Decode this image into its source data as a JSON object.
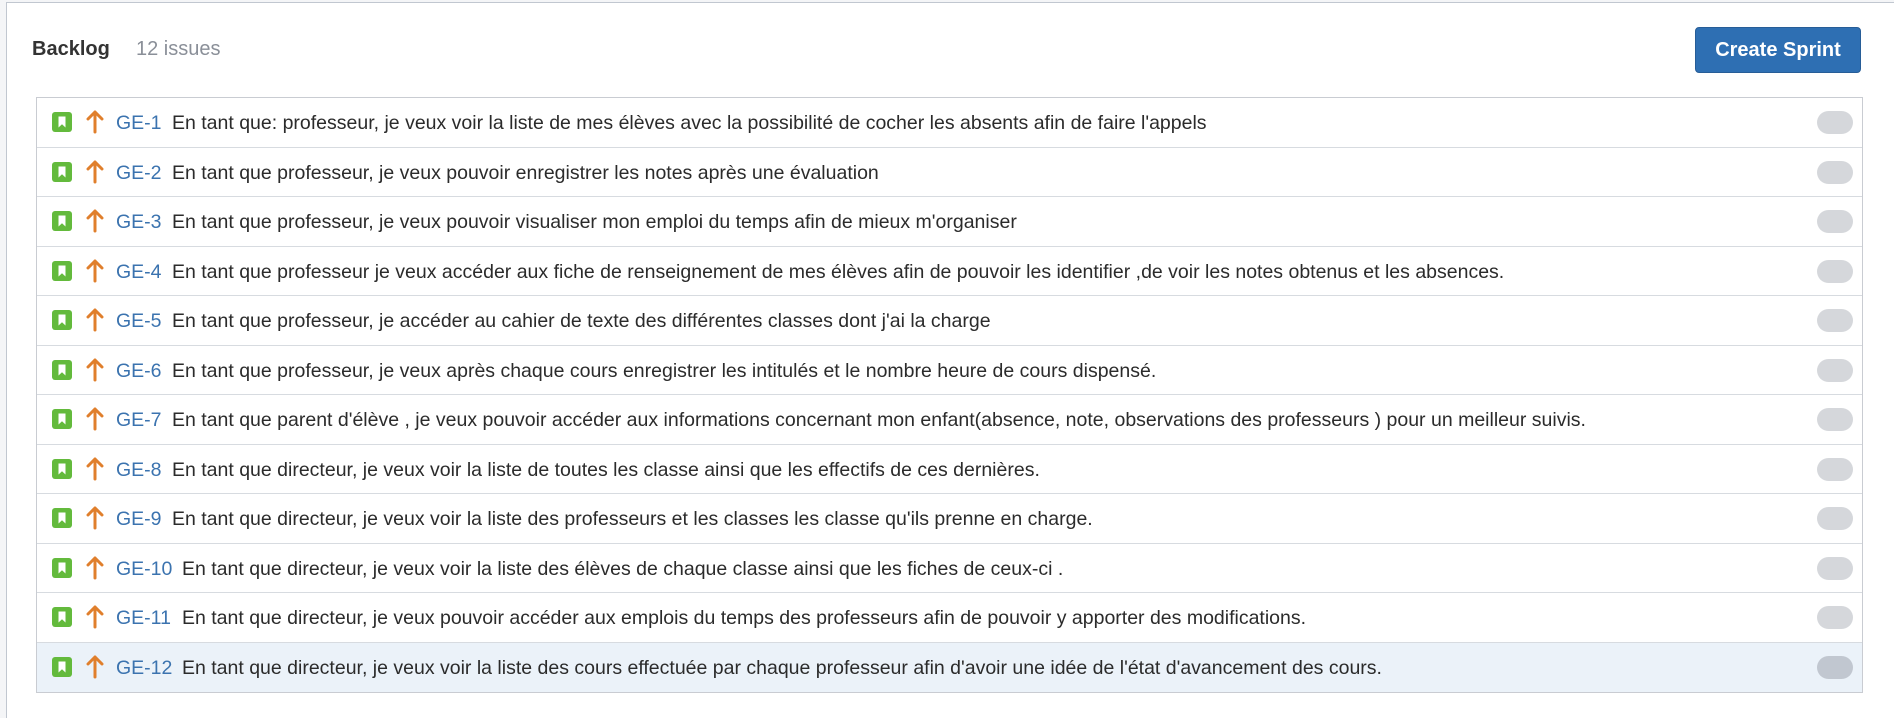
{
  "backlog": {
    "title": "Backlog",
    "issue_count": "12 issues",
    "create_sprint_label": "Create Sprint"
  },
  "colors": {
    "story_icon": "#63ba3c",
    "priority_icon": "#e07f2c",
    "issue_key": "#3b73af",
    "create_sprint_button": "#2e6fb3",
    "selected_row": "#ebf2f9"
  },
  "issues": [
    {
      "key": "GE-1",
      "summary": "En tant que: professeur, je veux voir la liste de mes élèves avec la possibilité de cocher les absents afin de faire l'appels",
      "type_icon": "story-icon",
      "priority_icon": "arrow-up-icon"
    },
    {
      "key": "GE-2",
      "summary": "En tant que professeur, je veux pouvoir enregistrer les notes après une évaluation",
      "type_icon": "story-icon",
      "priority_icon": "arrow-up-icon"
    },
    {
      "key": "GE-3",
      "summary": "En tant que professeur, je veux pouvoir visualiser mon emploi du temps afin de mieux m'organiser",
      "type_icon": "story-icon",
      "priority_icon": "arrow-up-icon"
    },
    {
      "key": "GE-4",
      "summary": "En tant que professeur je veux accéder aux fiche de renseignement de mes élèves afin de pouvoir les identifier ,de voir les notes obtenus et les absences.",
      "type_icon": "story-icon",
      "priority_icon": "arrow-up-icon"
    },
    {
      "key": "GE-5",
      "summary": "En tant que professeur, je accéder au cahier de texte des différentes classes dont j'ai la charge",
      "type_icon": "story-icon",
      "priority_icon": "arrow-up-icon"
    },
    {
      "key": "GE-6",
      "summary": "En tant que professeur, je veux après chaque cours enregistrer les intitulés et le nombre heure de cours dispensé.",
      "type_icon": "story-icon",
      "priority_icon": "arrow-up-icon"
    },
    {
      "key": "GE-7",
      "summary": "En tant que parent d'élève , je veux pouvoir accéder aux informations concernant mon enfant(absence, note, observations des professeurs ) pour un meilleur suivis.",
      "type_icon": "story-icon",
      "priority_icon": "arrow-up-icon"
    },
    {
      "key": "GE-8",
      "summary": "En tant que directeur, je veux voir la liste de toutes les classe ainsi que les effectifs de ces dernières.",
      "type_icon": "story-icon",
      "priority_icon": "arrow-up-icon"
    },
    {
      "key": "GE-9",
      "summary": "En tant que directeur, je veux voir la liste des professeurs et les classes les classe qu'ils prenne en charge.",
      "type_icon": "story-icon",
      "priority_icon": "arrow-up-icon"
    },
    {
      "key": "GE-10",
      "summary": "En tant que directeur, je veux voir la liste des élèves de chaque classe ainsi que les fiches de ceux-ci .",
      "type_icon": "story-icon",
      "priority_icon": "arrow-up-icon"
    },
    {
      "key": "GE-11",
      "summary": "En tant que directeur, je veux pouvoir accéder aux emplois du temps des professeurs afin de pouvoir y apporter des modifications.",
      "type_icon": "story-icon",
      "priority_icon": "arrow-up-icon"
    },
    {
      "key": "GE-12",
      "summary": "En tant que directeur, je veux voir la liste des cours effectuée par chaque professeur afin d'avoir une idée de l'état d'avancement des cours.",
      "type_icon": "story-icon",
      "priority_icon": "arrow-up-icon",
      "selected": true
    }
  ]
}
